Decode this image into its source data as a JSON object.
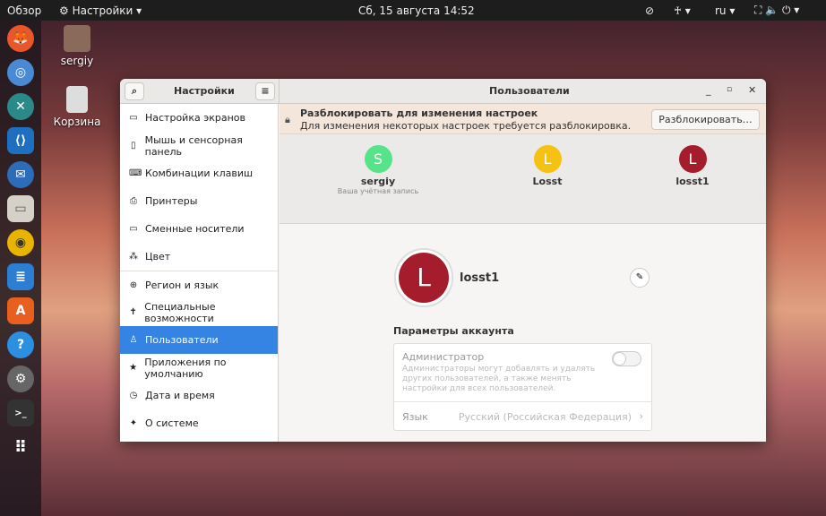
{
  "topbar": {
    "overview": "Обзор",
    "app_menu": "Настройки ▾",
    "clock": "Сб, 15 августа  14:52",
    "lang": "ru ▾"
  },
  "desktop": {
    "home": "sergiy",
    "trash": "Корзина"
  },
  "window": {
    "sidebar_title": "Настройки",
    "main_title": "Пользователи",
    "sidebar": [
      {
        "icon": "display-icon",
        "glyph": "▭",
        "label": "Настройка экранов"
      },
      {
        "icon": "mouse-icon",
        "glyph": "▯",
        "label": "Мышь и сенсорная панель"
      },
      {
        "icon": "keyboard-icon",
        "glyph": "⌨",
        "label": "Комбинации клавиш"
      },
      {
        "icon": "printer-icon",
        "glyph": "⎙",
        "label": "Принтеры"
      },
      {
        "icon": "media-icon",
        "glyph": "▭",
        "label": "Сменные носители"
      },
      {
        "icon": "color-icon",
        "glyph": "⁂",
        "label": "Цвет"
      },
      {
        "icon": "globe-icon",
        "glyph": "⊕",
        "label": "Регион и язык"
      },
      {
        "icon": "accessibility-icon",
        "glyph": "✝",
        "label": "Специальные возможности"
      },
      {
        "icon": "user-icon",
        "glyph": "♙",
        "label": "Пользователи"
      },
      {
        "icon": "star-icon",
        "glyph": "★",
        "label": "Приложения по умолчанию"
      },
      {
        "icon": "clock-icon",
        "glyph": "◷",
        "label": "Дата и время"
      },
      {
        "icon": "info-icon",
        "glyph": "✦",
        "label": "О системе"
      }
    ],
    "banner": {
      "title": "Разблокировать для изменения настроек",
      "subtitle": "Для изменения некоторых настроек требуется разблокировка.",
      "button": "Разблокировать…"
    },
    "users": [
      {
        "initial": "S",
        "name": "sergiy",
        "sub": "Ваша учётная запись",
        "color": "#57e389"
      },
      {
        "initial": "L",
        "name": "Losst",
        "sub": "",
        "color": "#f5c211"
      },
      {
        "initial": "L",
        "name": "losst1",
        "sub": "",
        "color": "#a51d2d"
      }
    ],
    "selected": {
      "initial": "L",
      "name": "losst1",
      "color": "#a51d2d"
    },
    "account": {
      "heading": "Параметры аккаунта",
      "admin_label": "Администратор",
      "admin_desc": "Администраторы могут добавлять и удалять других пользователей, а также менять настройки для всех пользователей.",
      "admin_enabled": false,
      "lang_label": "Язык",
      "lang_value": "Русский (Российская Федерация)"
    }
  }
}
